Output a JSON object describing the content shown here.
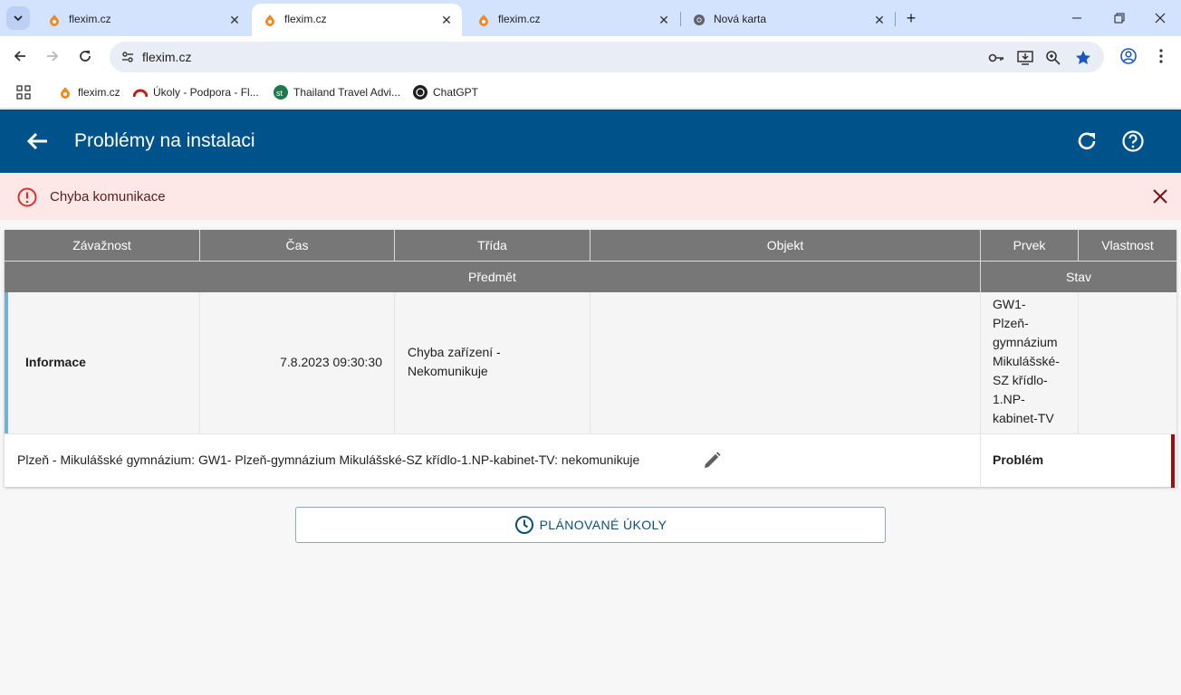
{
  "browser": {
    "tabs": [
      {
        "title": "flexim.cz",
        "icon": "flexim-favicon",
        "active": false
      },
      {
        "title": "flexim.cz",
        "icon": "flexim-favicon",
        "active": true
      },
      {
        "title": "flexim.cz",
        "icon": "flexim-favicon",
        "active": false
      },
      {
        "title": "Nová karta",
        "icon": "chrome-favicon",
        "active": false
      }
    ],
    "url": "flexim.cz",
    "bookmarks": [
      {
        "label": "flexim.cz",
        "icon": "flexim-favicon"
      },
      {
        "label": "Úkoly - Podpora - Fl...",
        "icon": "redmine-favicon"
      },
      {
        "label": "Thailand Travel Advi...",
        "icon": "st-favicon"
      },
      {
        "label": "ChatGPT",
        "icon": "chatgpt-favicon"
      }
    ]
  },
  "app": {
    "title": "Problémy na instalaci",
    "accent": "#00538a"
  },
  "alert": {
    "message": "Chyba komunikace",
    "color": "#fde8e7"
  },
  "table": {
    "headers": [
      "Závažnost",
      "Čas",
      "Třída",
      "Objekt",
      "Prvek",
      "Vlastnost"
    ],
    "subheaders": [
      "Předmět",
      "Stav"
    ],
    "rows": [
      {
        "severity": "Informace",
        "time": "7.8.2023 09:30:30",
        "class_lines": [
          "Chyba zařízení -",
          "Nekomunikuje"
        ],
        "object": "",
        "element_lines": [
          "GW1-",
          "Plzeň-",
          "gymnázium",
          "Mikulášské-",
          "SZ křídlo-",
          "1.NP-",
          "kabinet-TV"
        ],
        "property": "",
        "subject": "Plzeň - Mikulášské gymnázium: GW1- Plzeň-gymnázium Mikulášské-SZ křídlo-1.NP-kabinet-TV: nekomunikuje",
        "state": "Problém",
        "severity_color": "#6fb1d8",
        "state_color": "#a30d0d"
      }
    ]
  },
  "planned_button": {
    "label": "PLÁNOVANÉ ÚKOLY",
    "icon": "clock-icon"
  }
}
